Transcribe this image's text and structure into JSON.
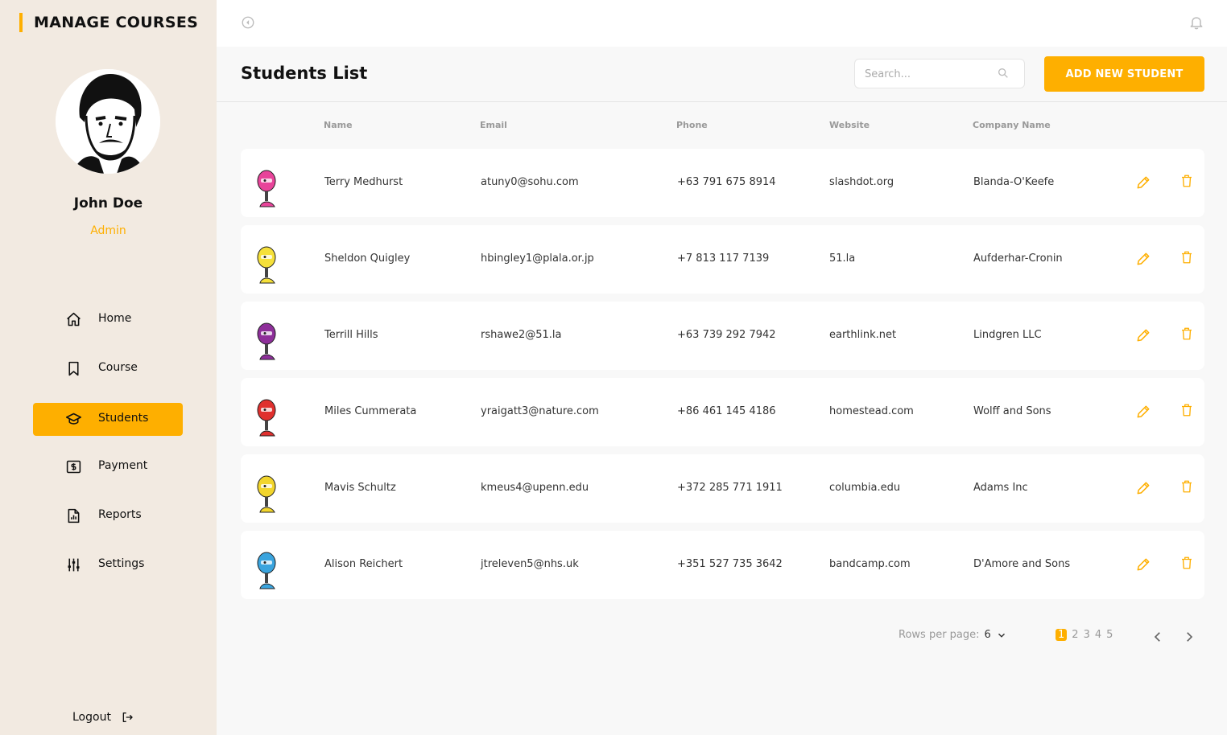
{
  "app": {
    "title": "MANAGE COURSES"
  },
  "user": {
    "name": "John Doe",
    "role": "Admin"
  },
  "nav": {
    "items": [
      {
        "label": "Home",
        "icon": "home-icon"
      },
      {
        "label": "Course",
        "icon": "bookmark-icon"
      },
      {
        "label": "Students",
        "icon": "graduation-cap-icon",
        "active": true
      },
      {
        "label": "Payment",
        "icon": "dollar-card-icon"
      },
      {
        "label": "Reports",
        "icon": "report-file-icon"
      },
      {
        "label": "Settings",
        "icon": "sliders-icon"
      }
    ],
    "logout_label": "Logout"
  },
  "header": {
    "title": "Students List",
    "search_placeholder": "Search...",
    "add_button_label": "ADD NEW STUDENT"
  },
  "table": {
    "columns": [
      "Name",
      "Email",
      "Phone",
      "Website",
      "Company Name"
    ],
    "rows": [
      {
        "name": "Terry Medhurst",
        "email": "atuny0@sohu.com",
        "phone": "+63 791 675 8914",
        "website": "slashdot.org",
        "company": "Blanda-O'Keefe",
        "avatar_color": "#e8449a"
      },
      {
        "name": "Sheldon Quigley",
        "email": "hbingley1@plala.or.jp",
        "phone": "+7 813 117 7139",
        "website": "51.la",
        "company": "Aufderhar-Cronin",
        "avatar_color": "#f5e03a"
      },
      {
        "name": "Terrill Hills",
        "email": "rshawe2@51.la",
        "phone": "+63 739 292 7942",
        "website": "earthlink.net",
        "company": "Lindgren LLC",
        "avatar_color": "#8e2f9a"
      },
      {
        "name": "Miles Cummerata",
        "email": "yraigatt3@nature.com",
        "phone": "+86 461 145 4186",
        "website": "homestead.com",
        "company": "Wolff and Sons",
        "avatar_color": "#e0302e"
      },
      {
        "name": "Mavis Schultz",
        "email": "kmeus4@upenn.edu",
        "phone": "+372 285 771 1911",
        "website": "columbia.edu",
        "company": "Adams Inc",
        "avatar_color": "#f2d52c"
      },
      {
        "name": "Alison Reichert",
        "email": "jtreleven5@nhs.uk",
        "phone": "+351 527 735 3642",
        "website": "bandcamp.com",
        "company": "D'Amore and Sons",
        "avatar_color": "#3aa4de"
      }
    ]
  },
  "pagination": {
    "rows_per_page_label": "Rows per page:",
    "rows_per_page_value": "6",
    "pages": [
      "1",
      "2",
      "3",
      "4",
      "5"
    ],
    "current_page": "1"
  },
  "colors": {
    "accent": "#feaf00",
    "sidebar_bg": "#f2eae1",
    "page_bg": "#f8f8f8"
  }
}
